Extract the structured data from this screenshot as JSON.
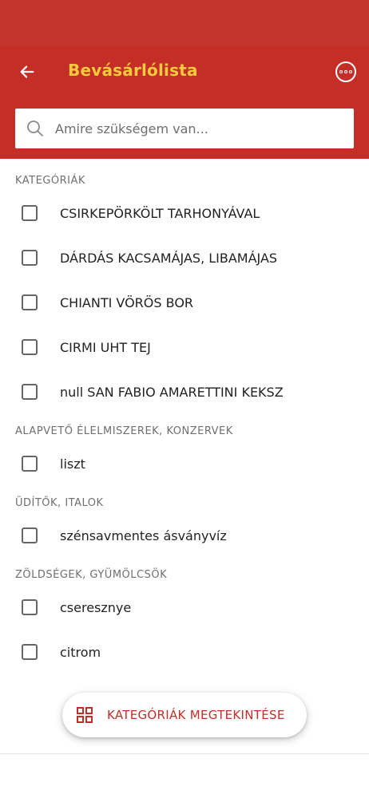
{
  "header": {
    "title": "Bevásárlólista",
    "back_icon": "arrow-left-icon",
    "more_icon": "more-options-icon"
  },
  "search": {
    "placeholder": "Amire szükségem van...",
    "value": "",
    "icon": "search-icon"
  },
  "sections": [
    {
      "title": "KATEGÓRIÁK",
      "items": [
        {
          "label": "CSIRKEPÖRKÖLT TARHONYÁVAL",
          "checked": false
        },
        {
          "label": "DÁRDÁS KACSAMÁJAS, LIBAMÁJAS",
          "checked": false
        },
        {
          "label": "CHIANTI VÖRÖS BOR",
          "checked": false
        },
        {
          "label": "CIRMI UHT TEJ",
          "checked": false
        },
        {
          "label": "null SAN FABIO AMARETTINI KEKSZ",
          "checked": false
        }
      ]
    },
    {
      "title": "ALAPVETŐ ÉLELMISZEREK, KONZERVEK",
      "items": [
        {
          "label": "liszt",
          "checked": false
        }
      ]
    },
    {
      "title": "ÜDÍTŐK, ITALOK",
      "items": [
        {
          "label": "szénsavmentes ásványvíz",
          "checked": false
        }
      ]
    },
    {
      "title": "ZÖLDSÉGEK, GYÜMÖLCSÖK",
      "items": [
        {
          "label": "cseresznye",
          "checked": false
        },
        {
          "label": "citrom",
          "checked": false
        }
      ]
    }
  ],
  "fab": {
    "label": "KATEGÓRIÁK MEGTEKINTÉSE",
    "icon": "grid-icon"
  },
  "colors": {
    "primary": "#c42e27",
    "status_bar": "#c43530",
    "title": "#f7c93e",
    "accent_text": "#c42e27"
  }
}
